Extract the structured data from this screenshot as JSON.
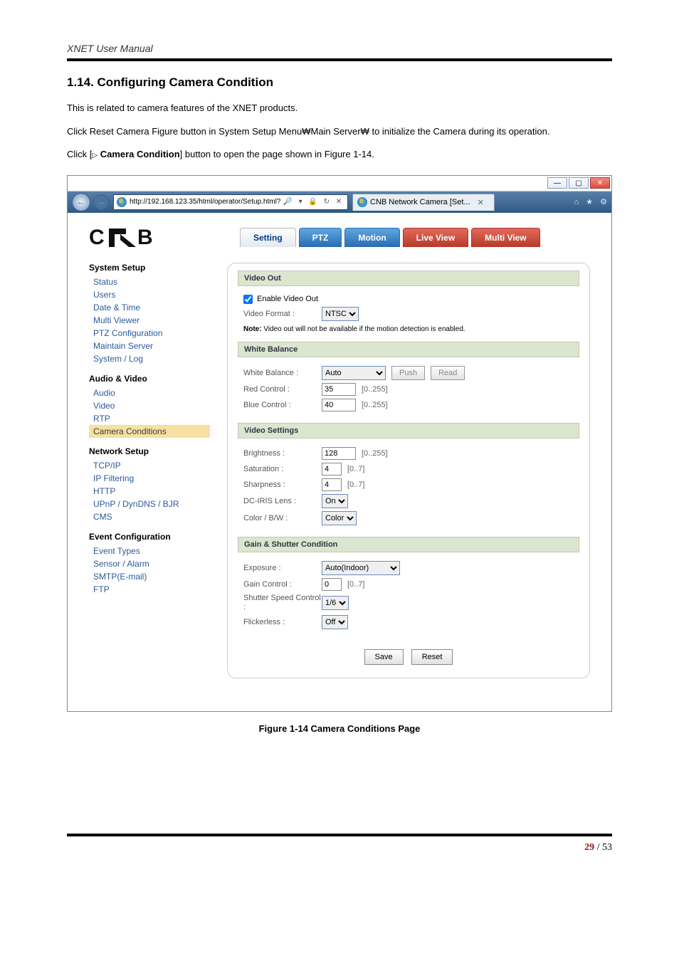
{
  "doc": {
    "header": "XNET User Manual"
  },
  "section": {
    "title": "1.14. Configuring Camera Condition",
    "p1": "This is related to camera features of the XNET products.",
    "p2a": "Click Reset Camera Figure button in System Setup Menu",
    "p2b": "Main Server",
    "p2c": " to initialize the Camera during its operation.",
    "p3a": "Click [",
    "p3b": " Camera Condition",
    "p3c": "] button to open the page shown in Figure 1-14.",
    "sep": "₩",
    "tri": "▷"
  },
  "ie": {
    "url": "http://192.168.123.35/html/operator/Setup.html?",
    "search_icons": "🔎 ▾  🔒 ↻ ✕",
    "tab": "CNB Network Camera [Set...",
    "home": "⌂",
    "star": "★",
    "gear": "⚙"
  },
  "brand": "CNB",
  "tabs": {
    "setting": "Setting",
    "ptz": "PTZ",
    "motion": "Motion",
    "live": "Live View",
    "multi": "Multi View"
  },
  "side": {
    "g1": "System Setup",
    "g1i": [
      "Status",
      "Users",
      "Date & Time",
      "Multi Viewer",
      "PTZ Configuration",
      "Maintain Server",
      "System / Log"
    ],
    "g2": "Audio & Video",
    "g2i": [
      "Audio",
      "Video",
      "RTP",
      "Camera Conditions"
    ],
    "g3": "Network Setup",
    "g3i": [
      "TCP/IP",
      "IP Filtering",
      "HTTP",
      "UPnP / DynDNS / BJR",
      "CMS"
    ],
    "g4": "Event Configuration",
    "g4i": [
      "Event Types",
      "Sensor / Alarm",
      "SMTP(E-mail)",
      "FTP"
    ]
  },
  "panel": {
    "vo_h": "Video Out",
    "vo_enable": "Enable Video Out",
    "vo_fmt_l": "Video Format :",
    "vo_fmt_v": "NTSC",
    "vo_note_b": "Note:",
    "vo_note": " Video out will not be available if the motion detection is enabled.",
    "wb_h": "White Balance",
    "wb_l": "White Balance :",
    "wb_v": "Auto",
    "wb_push": "Push",
    "wb_read": "Read",
    "red_l": "Red Control :",
    "red_v": "35",
    "blue_l": "Blue Control :",
    "blue_v": "40",
    "r255": "[0..255]",
    "vs_h": "Video Settings",
    "br_l": "Brightness :",
    "br_v": "128",
    "sat_l": "Saturation :",
    "sat_v": "4",
    "shp_l": "Sharpness :",
    "shp_v": "4",
    "r7": "[0..7]",
    "dc_l": "DC-IRIS Lens :",
    "dc_v": "On",
    "cbw_l": "Color / B/W :",
    "cbw_v": "Color",
    "gs_h": "Gain & Shutter Condition",
    "exp_l": "Exposure :",
    "exp_v": "Auto(Indoor)",
    "gc_l": "Gain Control :",
    "gc_v": "0",
    "ss_l": "Shutter Speed Control :",
    "ss_v": "1/6",
    "fl_l": "Flickerless :",
    "fl_v": "Off",
    "save": "Save",
    "reset": "Reset"
  },
  "figcap": "Figure 1-14 Camera Conditions Page",
  "pageno": {
    "cur": "29",
    "sep": " / ",
    "total": "53"
  }
}
